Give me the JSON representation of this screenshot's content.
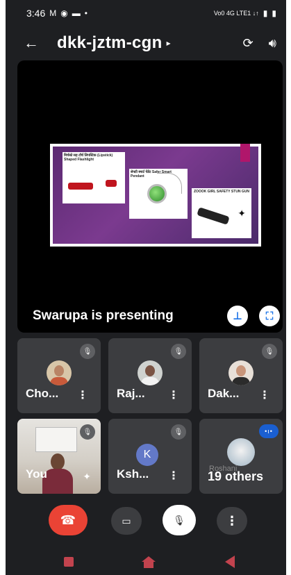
{
  "status_bar": {
    "time": "3:46",
    "network_label": "Vo0 4G LTE1 ↓↑"
  },
  "meeting": {
    "code": "dkk-jztm-cgn"
  },
  "slide": {
    "card1_title": "मिर्चस्प्रे सह टॉर्च लिपस्टिक (Lipstick) Shaped Flashlight",
    "card2_title": "सेफ्टी स्मार्ट पेंडेंट Safer Smart Pendant",
    "card3_title": "ZOOOK GIRL SAFETY STUN GUN"
  },
  "presentation": {
    "label": "Swarupa is presenting"
  },
  "participants": [
    {
      "name": "Cho...",
      "muted": true
    },
    {
      "name": "Raj...",
      "muted": true
    },
    {
      "name": "Dak...",
      "muted": true
    },
    {
      "name": "You",
      "muted": true
    },
    {
      "name": "Ksh...",
      "initial": "K",
      "avatar_color": "#6379c8",
      "muted": true
    }
  ],
  "others": {
    "label": "19 others",
    "watermark": "Roshani"
  },
  "colors": {
    "end_call": "#ea4335",
    "accent_blue": "#1a73e8",
    "tile_bg": "#3c3d40",
    "background": "#1e1f22",
    "nav_icon": "#c2434e"
  },
  "icons": {
    "back": "back-arrow-icon",
    "switch_camera": "switch-camera-icon",
    "audio": "speaker-icon",
    "pin": "pin-icon",
    "fullscreen": "fullscreen-icon",
    "mic_off": "mic-off-icon",
    "end_call": "phone-hangup-icon",
    "camera": "camera-icon",
    "more": "more-vert-icon"
  }
}
